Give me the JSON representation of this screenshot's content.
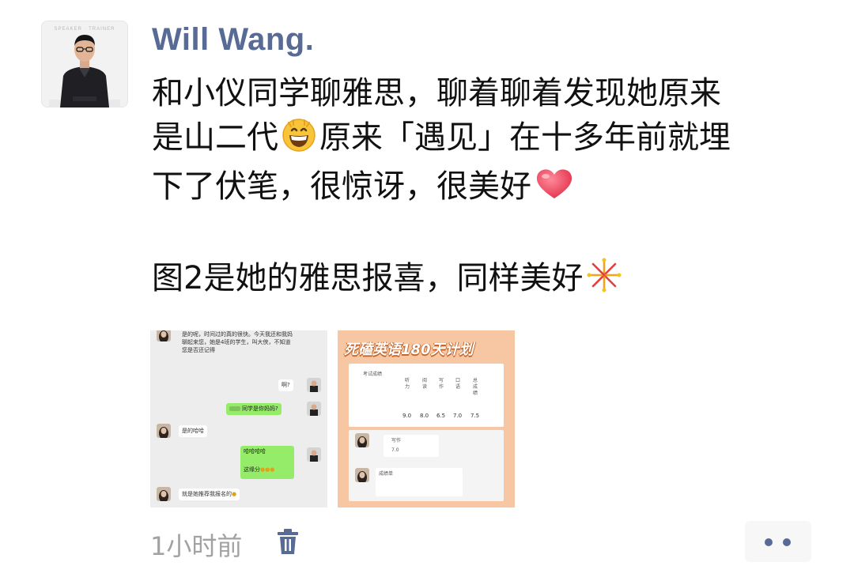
{
  "author": {
    "name": "Will Wang.",
    "avatar_brand": "SPEAKER · TRAINER"
  },
  "post": {
    "line1": "和小仪同学聊雅思，聊着聊着发现她原来",
    "line2a": "是山二代",
    "line2b": "原来「遇见」在十多年前就埋",
    "line3": "下了伏笔，很惊讶，很美好",
    "line4": "图2是她的雅思报喜，同样美好",
    "emoji": {
      "grin": "grinning-face-icon",
      "heart": "heart-icon",
      "fireworks": "fireworks-icon"
    }
  },
  "images": {
    "chat": {
      "msg1": "是的呢，时间过的真的很快。今天我还和我妈聊起来您，她是4班的学生，叫大侠，不知道您是否还记得",
      "msg2": "啊?",
      "msg3": "同学是你妈妈?",
      "msg4": "是的哈哈",
      "msg5a": "哈哈哈哈",
      "msg5b": "这缘分",
      "msg6": "就是她推荐我报名的"
    },
    "report": {
      "title": "死磕英语180天计划",
      "score_label": "考试成绩",
      "columns": [
        "听力",
        "阅读",
        "写作",
        "口语",
        "总成绩"
      ],
      "scores": [
        "9.0",
        "8.0",
        "6.5",
        "7.0",
        "7.5"
      ],
      "sub_label": "写作",
      "sub_value": "7.0",
      "second_label": "成绩单"
    }
  },
  "footer": {
    "time": "1小时前"
  },
  "colors": {
    "name": "#576b95",
    "time": "#a2a2a2",
    "report_bg": "#f6c7a2",
    "wechat_green": "#95ec69"
  }
}
